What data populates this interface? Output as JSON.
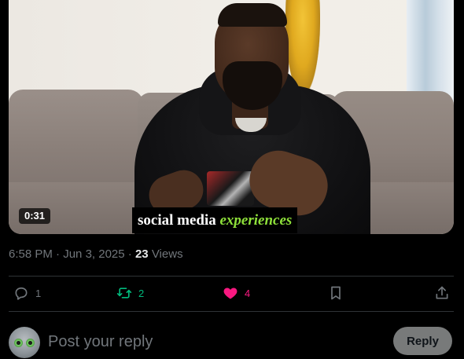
{
  "video": {
    "duration": "0:31",
    "caption_plain": "social media ",
    "caption_highlight": "experiences"
  },
  "meta": {
    "time": "6:58 PM",
    "separator": "·",
    "date": "Jun 3, 2025",
    "views_count": "23",
    "views_label": "Views"
  },
  "actions": {
    "reply_count": "1",
    "retweet_count": "2",
    "like_count": "4",
    "liked": true,
    "icons": [
      "reply-icon",
      "retweet-icon",
      "heart-icon",
      "bookmark-icon",
      "share-icon"
    ]
  },
  "composer": {
    "placeholder": "Post your reply",
    "value": "",
    "button_label": "Reply"
  },
  "colors": {
    "background": "#000000",
    "text": "#e7e9ea",
    "muted": "#71767b",
    "divider": "#2f3336",
    "retweet": "#00ba7c",
    "like": "#f91880",
    "caption_highlight": "#8ee03a",
    "reply_button_bg": "#787a7a"
  }
}
